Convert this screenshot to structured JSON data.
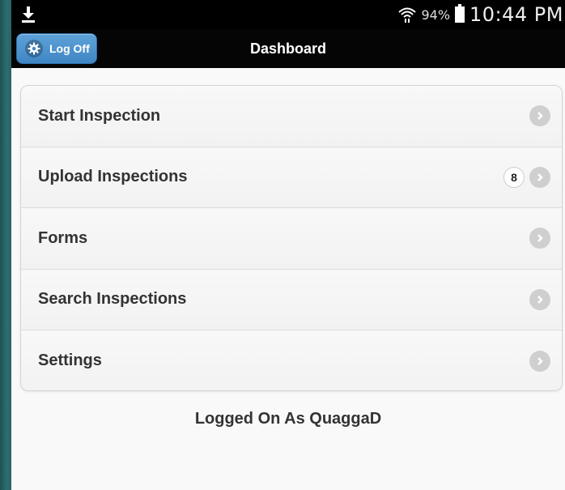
{
  "statusbar": {
    "battery_percent": "94%",
    "time": "10:44 PM",
    "icons": [
      "download-icon",
      "wifi-icon",
      "battery-icon"
    ]
  },
  "header": {
    "title": "Dashboard",
    "logoff_label": "Log Off",
    "logoff_icon": "gear-icon"
  },
  "menu": {
    "items": [
      {
        "label": "Start Inspection"
      },
      {
        "label": "Upload Inspections",
        "badge": "8"
      },
      {
        "label": "Forms"
      },
      {
        "label": "Search Inspections"
      },
      {
        "label": "Settings"
      }
    ]
  },
  "footer": {
    "logged_on_text": "Logged On As QuaggaD"
  },
  "colors": {
    "accent_button": "#4a90cc",
    "header_bg": "#000000",
    "list_bg": "#f6f6f6",
    "chevron_bg": "#cfcfcf"
  }
}
